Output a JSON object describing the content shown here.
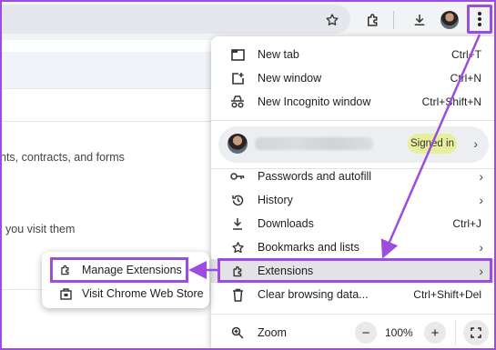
{
  "colors": {
    "annotation": "#9b4de0",
    "signed_in_badge": "#e8ef9c",
    "highlight_row": "#e3e3e6"
  },
  "toolbar": {
    "icons": [
      "star-icon",
      "extensions-puzzle-icon",
      "download-icon",
      "profile-avatar",
      "more-vert-icon"
    ]
  },
  "background": {
    "line1": "nts, contracts, and forms",
    "line2": "you visit them"
  },
  "menu": {
    "items_top": [
      {
        "icon": "new-tab-icon",
        "label": "New tab",
        "shortcut": "Ctrl+T"
      },
      {
        "icon": "new-window-icon",
        "label": "New window",
        "shortcut": "Ctrl+N"
      },
      {
        "icon": "incognito-icon",
        "label": "New Incognito window",
        "shortcut": "Ctrl+Shift+N"
      }
    ],
    "profile": {
      "badge": "Signed in"
    },
    "items_mid": [
      {
        "icon": "key-icon",
        "label": "Passwords and autofill"
      },
      {
        "icon": "history-icon",
        "label": "History"
      },
      {
        "icon": "download-icon",
        "label": "Downloads",
        "shortcut": "Ctrl+J"
      },
      {
        "icon": "star-icon",
        "label": "Bookmarks and lists"
      },
      {
        "icon": "extensions-puzzle-icon",
        "label": "Extensions"
      },
      {
        "icon": "trash-icon",
        "label": "Clear browsing data...",
        "shortcut": "Ctrl+Shift+Del"
      }
    ],
    "zoom": {
      "label": "Zoom",
      "value": "100%",
      "minus": "−",
      "plus": "+"
    }
  },
  "submenu": {
    "items": [
      {
        "icon": "extensions-puzzle-icon",
        "label": "Manage Extensions"
      },
      {
        "icon": "web-store-icon",
        "label": "Visit Chrome Web Store"
      }
    ]
  }
}
